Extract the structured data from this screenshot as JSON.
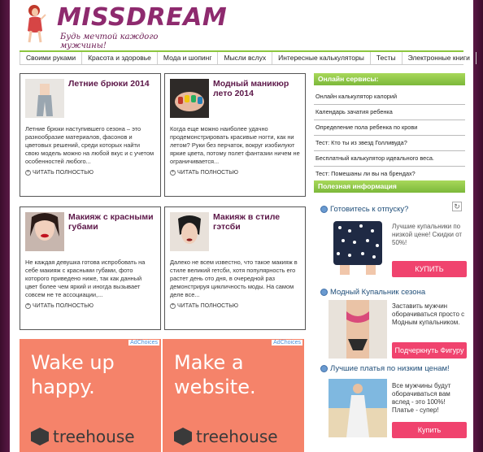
{
  "header": {
    "logo_title": "MISSDREAM",
    "logo_slogan": "Будь мечтой каждого мужчины!"
  },
  "nav": [
    "Своими руками",
    "Красота и здоровье",
    "Мода и шопинг",
    "Мысли вслух",
    "Интересные калькуляторы",
    "Тесты",
    "Электронные книги"
  ],
  "articles": [
    {
      "title": "Летние брюки 2014",
      "text": "Летние брюки наступившего сезона – это разнообразие материалов, фасонов и цветовых решений, среди которых найти свою модель можно на любой вкус и с учетом особенностей любого...",
      "more": "ЧИТАТЬ ПОЛНОСТЬЮ"
    },
    {
      "title": "Модный маникюр лето 2014",
      "text": "Когда еще можно наиболее удачно продемонстрировать красивые ногти, как ни летом? Руки без перчаток, вокруг изобилуют яркие цвета, потому полет фантазии ничем не ограничивается...",
      "more": "ЧИТАТЬ ПОЛНОСТЬЮ"
    },
    {
      "title": "Макияж с красными губами",
      "text": "Не каждая девушка готова испробовать на себе макияж с красными губами, фото которого приведено ниже, так как данный цвет более чем яркий и иногда вызывает совсем не те ассоциации,...",
      "more": "ЧИТАТЬ ПОЛНОСТЬЮ"
    },
    {
      "title": "Макияж в стиле гэтсби",
      "text": "Далеко не всем известно, что такое макияж в стиле великий гетсби, хотя популярность его растет день ото дня, в очередной раз демонстрируя цикличность моды. На самом деле все...",
      "more": "ЧИТАТЬ ПОЛНОСТЬЮ"
    }
  ],
  "ads": [
    {
      "adchoices": "AdChoices",
      "headline_1": "Wake up",
      "headline_2": "happy.",
      "brand": "treehouse"
    },
    {
      "adchoices": "AdChoices",
      "headline_1": "Make a",
      "headline_2": "website.",
      "brand": "treehouse"
    }
  ],
  "sidebar": {
    "services_title": "Онлайн сервисы:",
    "services": [
      "Онлайн калькулятор калорий",
      "Календарь зачатия ребенка",
      "Определение пола ребенка по крови",
      "Тест: Кто ты из звезд Голливуда?",
      "Бесплатный калькулятор идеального веса.",
      "Тест: Помешаны ли вы на брендах?"
    ],
    "info_title": "Полезная информация"
  },
  "promos": [
    {
      "title": "Готовитесь к отпуску?",
      "text": "Лучшие купальники по низкой цене! Скидки от 50%!",
      "button": "КУПИТЬ"
    },
    {
      "title": "Модный Купальник сезона",
      "text": "Заставить мужчин оборачиваться просто с Модным купальником.",
      "button": "Подчеркнуть Фигуру"
    },
    {
      "title": "Лучшие платья по низким ценам!",
      "text": "Все мужчины будут оборачиваться вам вслед - это 100%! Платье - супер!",
      "button": "Купить"
    }
  ],
  "colors": {
    "brand": "#8e2a6e",
    "accent_green": "#8cc63f",
    "ad_orange": "#f5836a",
    "button_pink": "#f0436e",
    "border": "#4a1238"
  }
}
